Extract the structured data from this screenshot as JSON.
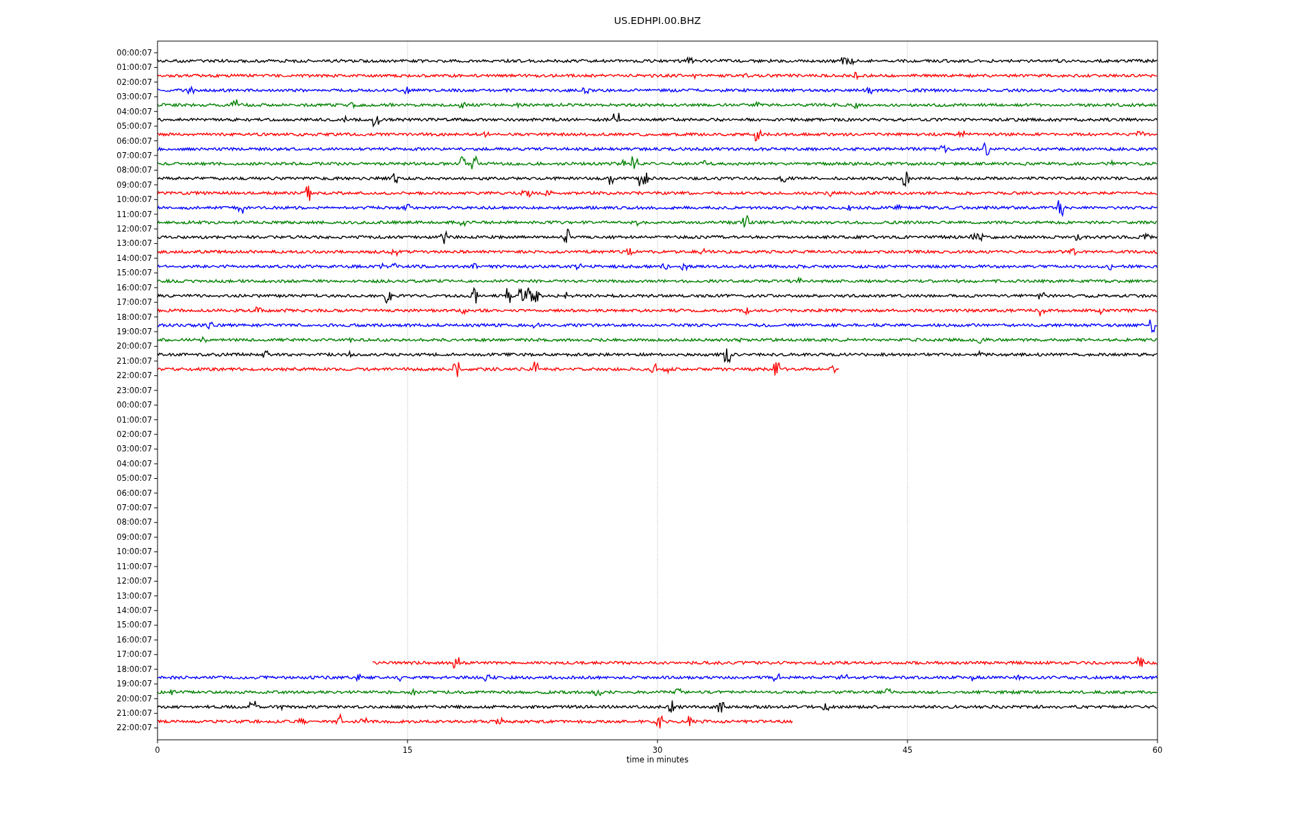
{
  "title": "US.EDHPI.00.BHZ",
  "xlabel": "time in minutes",
  "xticks": [
    "0",
    "15",
    "30",
    "45",
    "60"
  ],
  "rows": [
    {
      "label": "00:00:07",
      "trace": {
        "color": "#000000",
        "kind": "full"
      }
    },
    {
      "label": "01:00:07",
      "trace": {
        "color": "#ff0000",
        "kind": "full"
      }
    },
    {
      "label": "02:00:07",
      "trace": {
        "color": "#0000ff",
        "kind": "full"
      }
    },
    {
      "label": "03:00:07",
      "trace": {
        "color": "#008000",
        "kind": "full"
      }
    },
    {
      "label": "04:00:07",
      "trace": {
        "color": "#000000",
        "kind": "full"
      }
    },
    {
      "label": "05:00:07",
      "trace": {
        "color": "#ff0000",
        "kind": "full"
      }
    },
    {
      "label": "06:00:07",
      "trace": {
        "color": "#0000ff",
        "kind": "full"
      }
    },
    {
      "label": "07:00:07",
      "trace": {
        "color": "#008000",
        "kind": "full"
      }
    },
    {
      "label": "08:00:07",
      "trace": {
        "color": "#000000",
        "kind": "full"
      }
    },
    {
      "label": "09:00:07",
      "trace": {
        "color": "#ff0000",
        "kind": "full"
      }
    },
    {
      "label": "10:00:07",
      "trace": {
        "color": "#0000ff",
        "kind": "full"
      }
    },
    {
      "label": "11:00:07",
      "trace": {
        "color": "#008000",
        "kind": "full"
      }
    },
    {
      "label": "12:00:07",
      "trace": {
        "color": "#000000",
        "kind": "full"
      }
    },
    {
      "label": "13:00:07",
      "trace": {
        "color": "#ff0000",
        "kind": "full"
      }
    },
    {
      "label": "14:00:07",
      "trace": {
        "color": "#0000ff",
        "kind": "full"
      }
    },
    {
      "label": "15:00:07",
      "trace": {
        "color": "#008000",
        "kind": "full"
      }
    },
    {
      "label": "16:00:07",
      "trace": {
        "color": "#000000",
        "kind": "full"
      }
    },
    {
      "label": "17:00:07",
      "trace": {
        "color": "#ff0000",
        "kind": "full"
      }
    },
    {
      "label": "18:00:07",
      "trace": {
        "color": "#0000ff",
        "kind": "full"
      }
    },
    {
      "label": "19:00:07",
      "trace": {
        "color": "#008000",
        "kind": "full"
      }
    },
    {
      "label": "20:00:07",
      "trace": {
        "color": "#000000",
        "kind": "full"
      }
    },
    {
      "label": "21:00:07",
      "trace": {
        "color": "#ff0000",
        "kind": "early-end"
      }
    },
    {
      "label": "22:00:07"
    },
    {
      "label": "23:00:07"
    },
    {
      "label": "00:00:07"
    },
    {
      "label": "01:00:07"
    },
    {
      "label": "02:00:07"
    },
    {
      "label": "03:00:07"
    },
    {
      "label": "04:00:07"
    },
    {
      "label": "05:00:07"
    },
    {
      "label": "06:00:07"
    },
    {
      "label": "07:00:07"
    },
    {
      "label": "08:00:07"
    },
    {
      "label": "09:00:07"
    },
    {
      "label": "10:00:07"
    },
    {
      "label": "11:00:07"
    },
    {
      "label": "12:00:07"
    },
    {
      "label": "13:00:07"
    },
    {
      "label": "14:00:07"
    },
    {
      "label": "15:00:07"
    },
    {
      "label": "16:00:07"
    },
    {
      "label": "17:00:07",
      "trace": {
        "color": "#ff0000",
        "kind": "late-start"
      }
    },
    {
      "label": "18:00:07",
      "trace": {
        "color": "#0000ff",
        "kind": "full"
      }
    },
    {
      "label": "19:00:07",
      "trace": {
        "color": "#008000",
        "kind": "full"
      }
    },
    {
      "label": "20:00:07",
      "trace": {
        "color": "#000000",
        "kind": "full"
      }
    },
    {
      "label": "21:00:07",
      "trace": {
        "color": "#ff0000",
        "kind": "short-end"
      }
    },
    {
      "label": "22:00:07"
    }
  ]
}
